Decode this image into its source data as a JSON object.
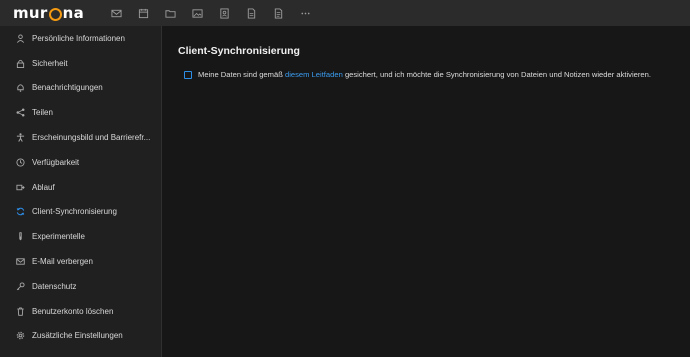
{
  "brand": {
    "name_before": "mur",
    "name_after": "na",
    "accent": "#f39a12"
  },
  "header": {
    "apps": [
      {
        "name": "mail-icon"
      },
      {
        "name": "calendar-icon"
      },
      {
        "name": "folder-icon"
      },
      {
        "name": "photos-icon"
      },
      {
        "name": "contacts-icon"
      },
      {
        "name": "notes-icon"
      },
      {
        "name": "document-icon"
      },
      {
        "name": "more-icon"
      }
    ]
  },
  "sidebar": {
    "items": [
      {
        "label": "Persönliche Informationen",
        "icon": "person-icon"
      },
      {
        "label": "Sicherheit",
        "icon": "lock-icon"
      },
      {
        "label": "Benachrichtigungen",
        "icon": "bell-icon"
      },
      {
        "label": "Teilen",
        "icon": "share-icon"
      },
      {
        "label": "Erscheinungsbild und Barrierefr...",
        "icon": "accessibility-icon"
      },
      {
        "label": "Verfügbarkeit",
        "icon": "clock-icon"
      },
      {
        "label": "Ablauf",
        "icon": "flow-icon"
      },
      {
        "label": "Client-Synchronisierung",
        "icon": "sync-icon",
        "active": true
      },
      {
        "label": "Experimentelle",
        "icon": "flask-icon"
      },
      {
        "label": "E-Mail verbergen",
        "icon": "mail-icon"
      },
      {
        "label": "Datenschutz",
        "icon": "key-icon"
      },
      {
        "label": "Benutzerkonto löschen",
        "icon": "trash-icon"
      },
      {
        "label": "Zusätzliche Einstellungen",
        "icon": "gear-icon"
      }
    ],
    "active_color": "#2d8ee8"
  },
  "main": {
    "title": "Client-Synchronisierung",
    "checkbox": {
      "checked": false,
      "text_before": "Meine Daten sind gemäß",
      "link_text": "diesem Leitfaden",
      "text_after": "gesichert, und ich möchte die Synchronisierung von Dateien und Notizen wieder aktivieren."
    }
  }
}
